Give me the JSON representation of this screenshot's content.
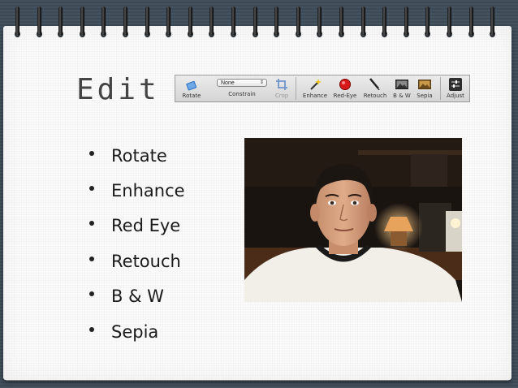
{
  "slide": {
    "title": "Edit"
  },
  "toolbar": {
    "rotate_label": "Rotate",
    "constrain_label": "Constrain",
    "constrain_value": "None",
    "crop_label": "Crop",
    "enhance_label": "Enhance",
    "redeye_label": "Red-Eye",
    "retouch_label": "Retouch",
    "bw_label": "B & W",
    "sepia_label": "Sepia",
    "adjust_label": "Adjust"
  },
  "bullets": [
    "Rotate",
    "Enhance",
    "Red Eye",
    "Retouch",
    "B & W",
    "Sepia"
  ],
  "colors": {
    "background": "#3f4c59",
    "page": "#fbfbfb",
    "title_text": "#444444",
    "bullet_text": "#1a1a1a",
    "redeye_icon": "#e02020"
  },
  "icons": [
    "rotate-icon",
    "crop-icon",
    "enhance-wand-icon",
    "red-eye-icon",
    "retouch-brush-icon",
    "bw-photo-icon",
    "sepia-photo-icon",
    "adjust-sliders-icon"
  ]
}
